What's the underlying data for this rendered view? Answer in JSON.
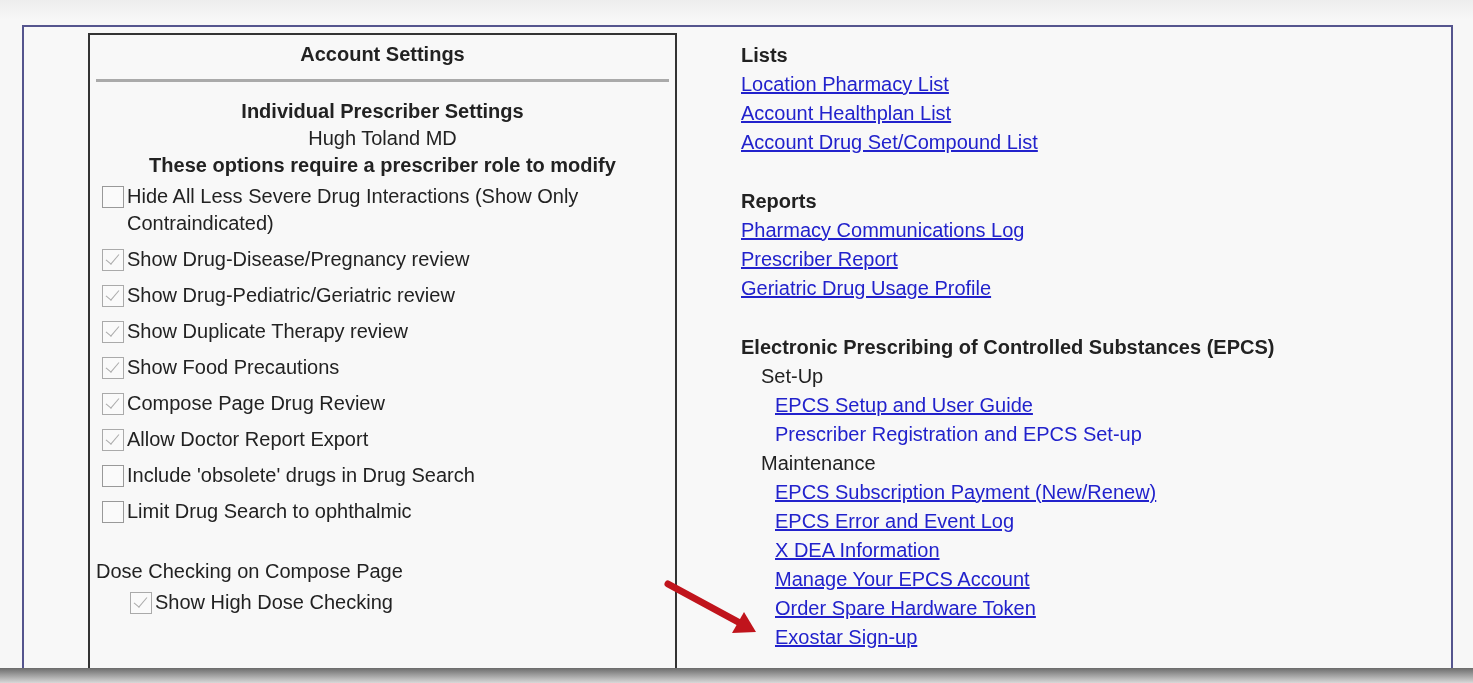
{
  "left_panel": {
    "title": "Account Settings",
    "section_title": "Individual Prescriber Settings",
    "prescriber": "Hugh Toland MD",
    "note": "These options require a prescriber role to modify",
    "options": [
      {
        "label": "Hide All Less Severe Drug Interactions (Show Only Contraindicated)",
        "checked": false
      },
      {
        "label": "Show Drug-Disease/Pregnancy review",
        "checked": true
      },
      {
        "label": "Show Drug-Pediatric/Geriatric review",
        "checked": true
      },
      {
        "label": "Show Duplicate Therapy review",
        "checked": true
      },
      {
        "label": "Show Food Precautions",
        "checked": true
      },
      {
        "label": "Compose Page Drug Review",
        "checked": true
      },
      {
        "label": "Allow Doctor Report Export",
        "checked": true
      },
      {
        "label": "Include 'obsolete' drugs in Drug Search",
        "checked": false
      },
      {
        "label": "Limit Drug Search to ophthalmic",
        "checked": false
      }
    ],
    "dose_checking": {
      "heading": "Dose Checking on Compose Page",
      "options": [
        {
          "label": "Show High Dose Checking",
          "checked": true
        }
      ]
    }
  },
  "right_panel": {
    "sections": [
      {
        "heading": "Lists",
        "items": [
          {
            "kind": "link",
            "text": "Location Pharmacy List",
            "underlined": true
          },
          {
            "kind": "link",
            "text": "Account Healthplan List",
            "underlined": true
          },
          {
            "kind": "link",
            "text": "Account Drug Set/Compound List",
            "underlined": true
          }
        ]
      },
      {
        "heading": "Reports",
        "items": [
          {
            "kind": "link",
            "text": "Pharmacy Communications Log",
            "underlined": true
          },
          {
            "kind": "link",
            "text": "Prescriber Report",
            "underlined": true
          },
          {
            "kind": "link",
            "text": "Geriatric Drug Usage Profile",
            "underlined": true
          }
        ]
      },
      {
        "heading": "Electronic Prescribing of Controlled Substances (EPCS)",
        "items": [
          {
            "kind": "subheading",
            "text": "Set-Up"
          },
          {
            "kind": "link",
            "text": "EPCS Setup and User Guide",
            "underlined": true
          },
          {
            "kind": "link",
            "text": "Prescriber Registration and EPCS Set-up",
            "underlined": false
          },
          {
            "kind": "subheading",
            "text": "Maintenance"
          },
          {
            "kind": "link",
            "text": "EPCS Subscription Payment (New/Renew)",
            "underlined": true
          },
          {
            "kind": "link",
            "text": "EPCS Error and Event Log",
            "underlined": true
          },
          {
            "kind": "link",
            "text": "X DEA Information",
            "underlined": true
          },
          {
            "kind": "link",
            "text": "Manage Your EPCS Account",
            "underlined": true
          },
          {
            "kind": "link",
            "text": "Order Spare Hardware Token",
            "underlined": true
          },
          {
            "kind": "link",
            "text": "Exostar Sign-up",
            "underlined": true
          }
        ]
      }
    ]
  }
}
